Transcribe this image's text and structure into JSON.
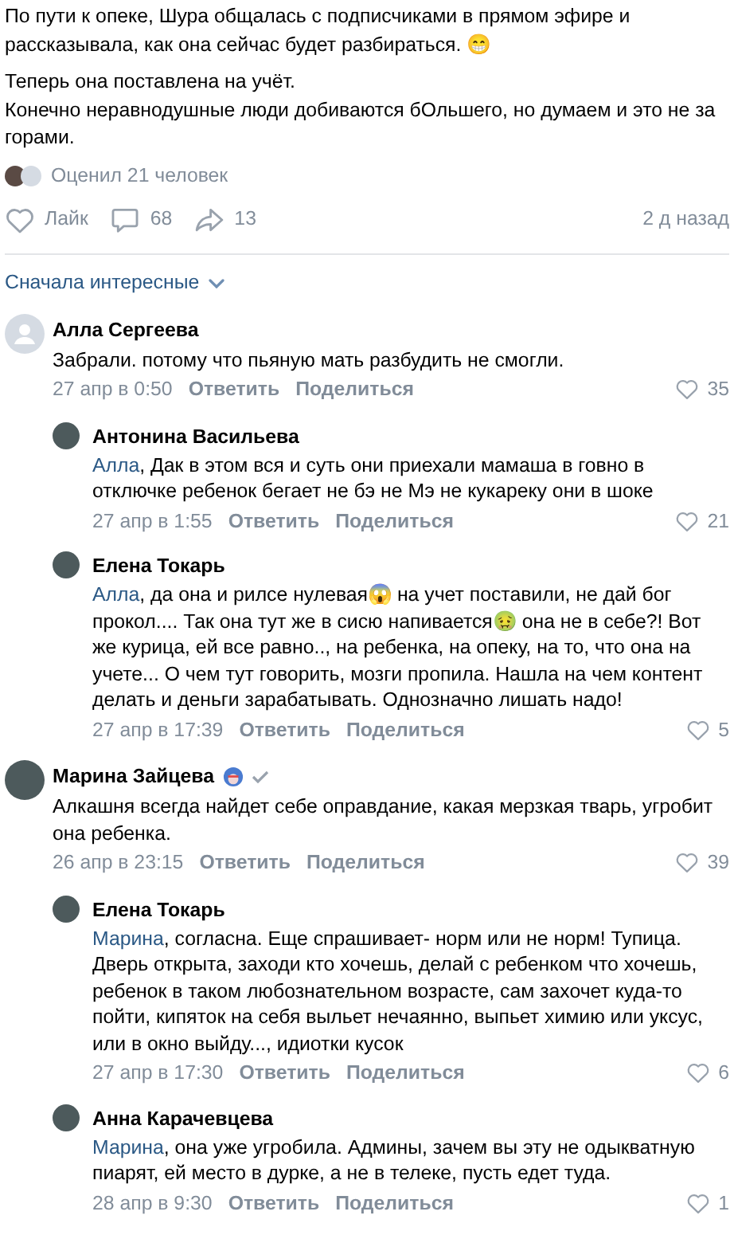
{
  "post": {
    "paragraphs": [
      "По пути к опеке, Шура общалась с подписчиками в прямом эфире и рассказывала, как она сейчас будет разбираться. 😁",
      "Теперь она поставлена на учёт.\nКонечно неравнодушные люди добиваются бОльшего, но думаем и это не за горами."
    ],
    "rated": "Оценил 21 человек",
    "actions": {
      "like": "Лайк",
      "comments": "68",
      "shares": "13",
      "time": "2 д назад"
    }
  },
  "sort": "Сначала интересные",
  "comments": [
    {
      "author": "Алла Сергеева",
      "kind": "no-photo",
      "verified": false,
      "text": "Забрали. потому что пьяную мать разбудить не смогли.",
      "date": "27 апр в 0:50",
      "reply": "Ответить",
      "share": "Поделиться",
      "likes": "35",
      "children": [
        {
          "author": "Антонина Васильева",
          "verified": false,
          "reply_to": "Алла",
          "text": ", Дак в этом вся и суть они приехали мамаша в говно в отключке ребенок бегает не бэ не Мэ не кукареку они в шоке",
          "date": "27 апр в 1:55",
          "reply": "Ответить",
          "share": "Поделиться",
          "likes": "21"
        },
        {
          "author": "Елена Токарь",
          "verified": false,
          "reply_to": "Алла",
          "text": ", да она и рилсе нулевая😱 на учет поставили, не дай бог прокол.... Так она тут же в сисю напивается🤢 она не в себе?! Вот же курица, ей все равно.., на ребенка, на опеку, на то, что она на учете... О чем тут говорить, мозги пропила. Нашла на чем контент делать и деньги зарабатывать. Однозначно лишать надо!",
          "date": "27 апр в 17:39",
          "reply": "Ответить",
          "share": "Поделиться",
          "likes": "5"
        }
      ]
    },
    {
      "author": "Марина Зайцева",
      "verified": true,
      "text": "Алкашня всегда найдет себе оправдание, какая мерзкая тварь, угробит она ребенка.",
      "date": "26 апр в 23:15",
      "reply": "Ответить",
      "share": "Поделиться",
      "likes": "39",
      "children": [
        {
          "author": "Елена Токарь",
          "verified": false,
          "reply_to": "Марина",
          "text": ", согласна. Еще спрашивает- норм или не норм! Тупица. Дверь открыта, заходи кто хочешь, делай с ребенком что хочешь, ребенок в таком любознательном возрасте, сам захочет куда-то пойти, кипяток на себя выльет нечаянно, выпьет химию или уксус, или в окно выйду..., идиотки кусок",
          "date": "27 апр в 17:30",
          "reply": "Ответить",
          "share": "Поделиться",
          "likes": "6"
        },
        {
          "author": "Анна Карачевцева",
          "verified": false,
          "reply_to": "Марина",
          "text": ", она уже угробила. Админы, зачем вы эту не одыкватную пиарят, ей место в дурке, а не в телеке, пусть едет туда.",
          "date": "28 апр в 9:30",
          "reply": "Ответить",
          "share": "Поделиться",
          "likes": "1"
        }
      ]
    }
  ]
}
